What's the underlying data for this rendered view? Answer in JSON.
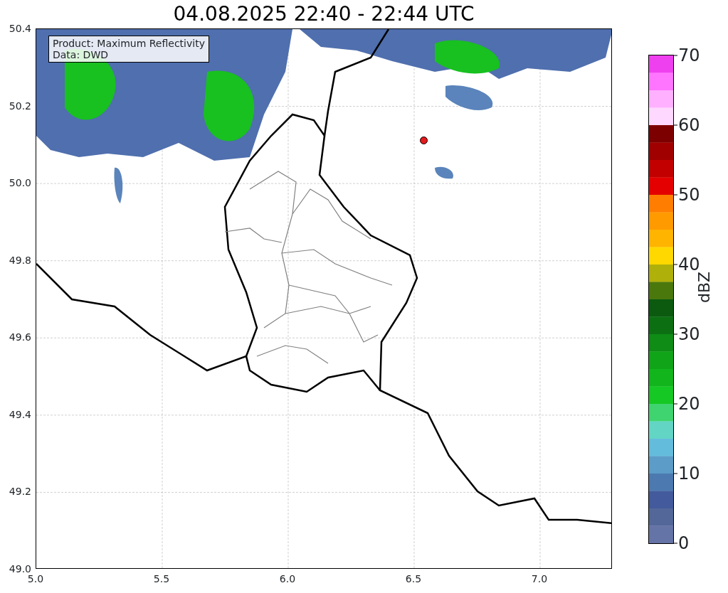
{
  "title": "04.08.2025 22:40 - 22:44 UTC",
  "map": {
    "legend": [
      "Product: Maximum Reflectivity",
      "Data: DWD"
    ],
    "x_ticks": [
      "5.0",
      "5.5",
      "6.0",
      "6.5",
      "7.0"
    ],
    "y_ticks": [
      "50.4",
      "50.2",
      "50.0",
      "49.8",
      "49.6",
      "49.4",
      "49.2",
      "49.0"
    ]
  },
  "colorbar": {
    "label": "dBZ",
    "ticks": [
      "70",
      "60",
      "50",
      "40",
      "30",
      "20",
      "10",
      "0"
    ],
    "segments": [
      {
        "color": "#ef40ef"
      },
      {
        "color": "#ff75ff"
      },
      {
        "color": "#ffb0ff"
      },
      {
        "color": "#ffd8ff"
      },
      {
        "color": "#7d0000"
      },
      {
        "color": "#a00000"
      },
      {
        "color": "#c20000"
      },
      {
        "color": "#e40000"
      },
      {
        "color": "#ff7d00"
      },
      {
        "color": "#ff9a00"
      },
      {
        "color": "#ffb400"
      },
      {
        "color": "#ffd800"
      },
      {
        "color": "#b0b00a"
      },
      {
        "color": "#4a780d"
      },
      {
        "color": "#0b5a10"
      },
      {
        "color": "#0c7013"
      },
      {
        "color": "#0e8c16"
      },
      {
        "color": "#10a518"
      },
      {
        "color": "#12b51c"
      },
      {
        "color": "#15c823"
      },
      {
        "color": "#3fd46f"
      },
      {
        "color": "#62d5c5"
      },
      {
        "color": "#64bcdc"
      },
      {
        "color": "#5b9cc8"
      },
      {
        "color": "#4c7ab0"
      },
      {
        "color": "#435b9c"
      },
      {
        "color": "#536799"
      },
      {
        "color": "#6474a6"
      }
    ]
  }
}
